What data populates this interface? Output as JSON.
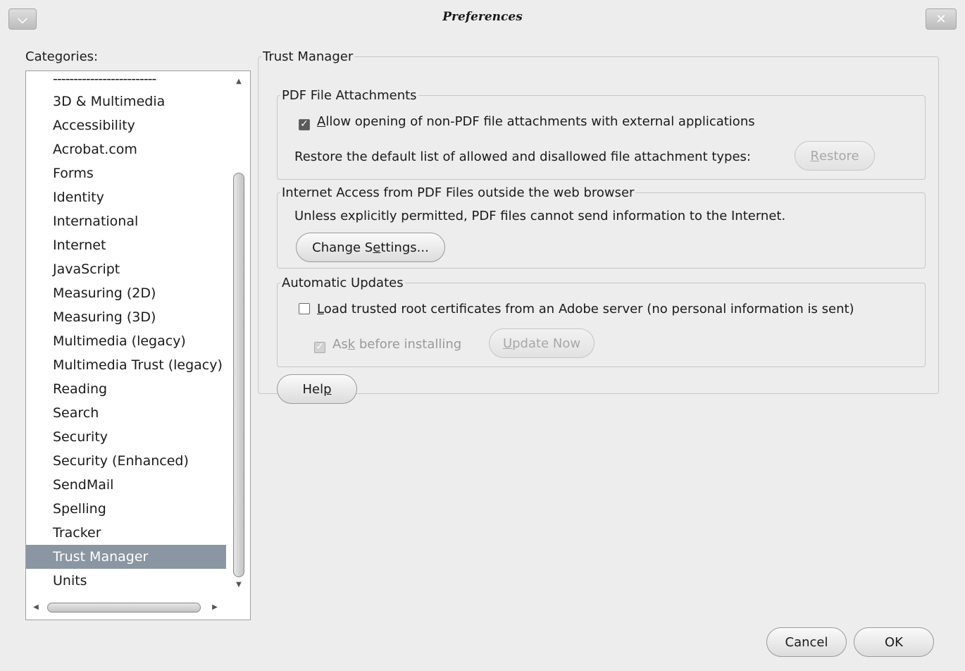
{
  "window": {
    "title": "Preferences"
  },
  "categories": {
    "label_pre": "Cate",
    "label_mnemonic": "g",
    "label_post": "ories:",
    "items": [
      "-------------------------",
      "3D & Multimedia",
      "Accessibility",
      "Acrobat.com",
      "Forms",
      "Identity",
      "International",
      "Internet",
      "JavaScript",
      "Measuring (2D)",
      "Measuring (3D)",
      "Multimedia (legacy)",
      "Multimedia Trust (legacy)",
      "Reading",
      "Search",
      "Security",
      "Security (Enhanced)",
      "SendMail",
      "Spelling",
      "Tracker",
      "Trust Manager",
      "Units"
    ],
    "selected": "Trust Manager"
  },
  "trust_manager": {
    "title": "Trust Manager",
    "pdf_attachments": {
      "legend": "PDF File Attachments",
      "allow_checkbox_mnemonic": "A",
      "allow_checkbox_rest": "llow opening of non-PDF file attachments with external applications",
      "allow_checked": true,
      "restore_text": "Restore the default list of allowed and disallowed file attachment types:",
      "restore_button_mnemonic": "R",
      "restore_button_rest": "estore"
    },
    "internet_access": {
      "legend": "Internet Access from PDF Files outside the web browser",
      "text": "Unless explicitly permitted, PDF files cannot send information to the Internet.",
      "change_settings_pre": "Change S",
      "change_settings_mnemonic": "e",
      "change_settings_post": "ttings..."
    },
    "automatic_updates": {
      "legend": "Automatic Updates",
      "load_mnemonic": "L",
      "load_rest": "oad trusted root certificates from an Adobe server (no personal information is sent)",
      "load_checked": false,
      "ask_pre": "As",
      "ask_mnemonic": "k",
      "ask_post": " before installing",
      "ask_checked": true,
      "update_mnemonic": "U",
      "update_rest": "pdate Now"
    },
    "help_pre": "Hel",
    "help_mnemonic": "p"
  },
  "footer": {
    "cancel": "Cancel",
    "ok": "OK"
  }
}
